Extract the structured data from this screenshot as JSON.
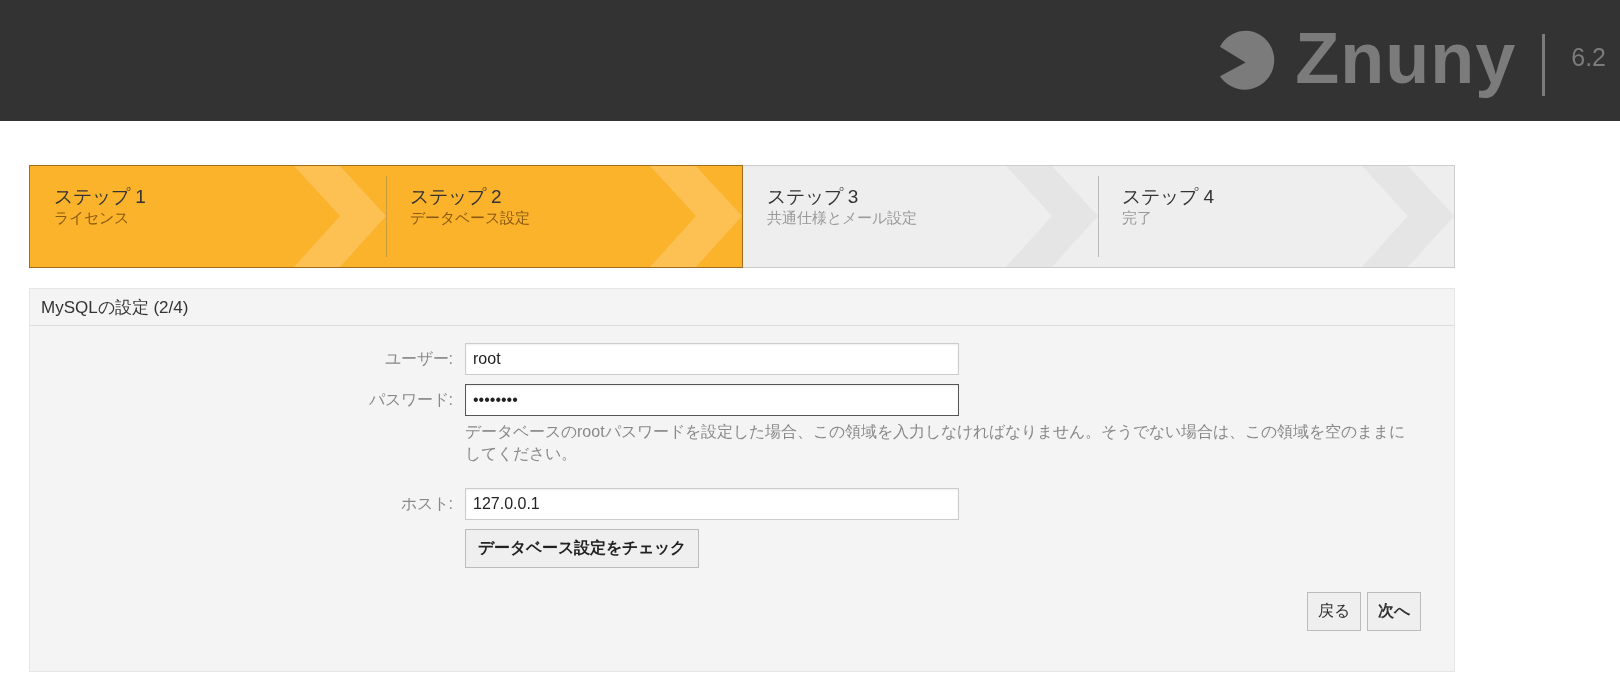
{
  "header": {
    "logo_text": "Znuny",
    "version": "6.2"
  },
  "steps": [
    {
      "title": "ステップ 1",
      "subtitle": "ライセンス",
      "completed": true
    },
    {
      "title": "ステップ 2",
      "subtitle": "データベース設定",
      "completed": true
    },
    {
      "title": "ステップ 3",
      "subtitle": "共通仕様とメール設定",
      "completed": false
    },
    {
      "title": "ステップ 4",
      "subtitle": "完了",
      "completed": false
    }
  ],
  "panel": {
    "title": "MySQLの設定 (2/4)",
    "fields": [
      {
        "label": "ユーザー:",
        "value": "root",
        "focused": false
      },
      {
        "label": "パスワード:",
        "value": "••••••••",
        "focused": true,
        "help": "データベースのrootパスワードを設定した場合、この領域を入力しなければなりません。そうでない場合は、この領域を空のままにしてください。"
      },
      {
        "label": "ホスト:",
        "value": "127.0.0.1",
        "focused": false
      }
    ],
    "check_button": "データベース設定をチェック",
    "buttons": [
      "戻る",
      "次へ"
    ]
  }
}
